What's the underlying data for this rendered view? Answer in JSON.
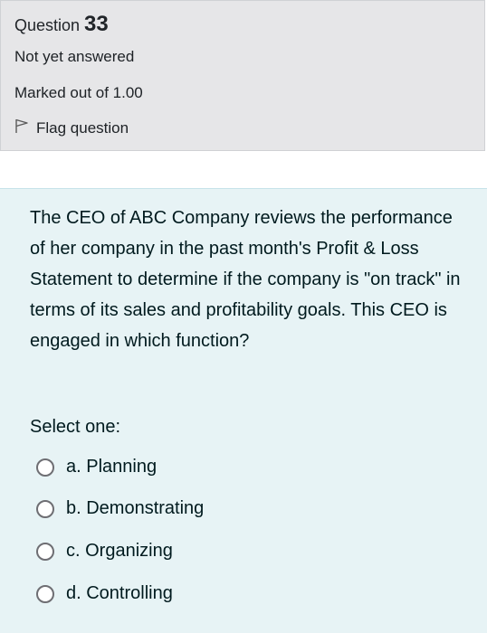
{
  "info": {
    "question_word": "Question",
    "question_number": "33",
    "state": "Not yet answered",
    "grade": "Marked out of 1.00",
    "flag_label": "Flag question"
  },
  "question": {
    "text": "The CEO of ABC Company reviews the performance of her company in the past month's Profit & Loss Statement to determine if the company is \"on track\" in terms of its sales and profitability goals. This CEO is engaged in which function?",
    "prompt": "Select one:",
    "options": [
      {
        "label": "a. Planning",
        "selected": false
      },
      {
        "label": "b. Demonstrating",
        "selected": false
      },
      {
        "label": "c. Organizing",
        "selected": false
      },
      {
        "label": "d. Controlling",
        "selected": false
      }
    ]
  },
  "icons": {
    "flag": "flag-icon",
    "radio": "radio-button"
  },
  "colors": {
    "info_bg": "#e6e6e8",
    "content_bg": "#e7f3f5",
    "text": "#001a1e"
  }
}
